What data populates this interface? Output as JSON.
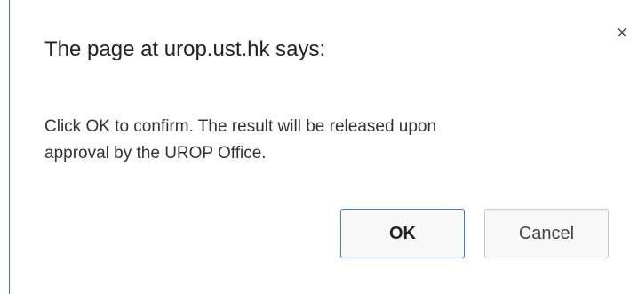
{
  "dialog": {
    "title": "The page at urop.ust.hk says:",
    "close_symbol": "×",
    "close_icon": "close-icon",
    "message_line1": "Click OK to confirm. The result will be released upon",
    "message_line2": "approval by the UROP Office.",
    "ok_label": "OK",
    "cancel_label": "Cancel",
    "accent_color": "#3d7ddb"
  }
}
